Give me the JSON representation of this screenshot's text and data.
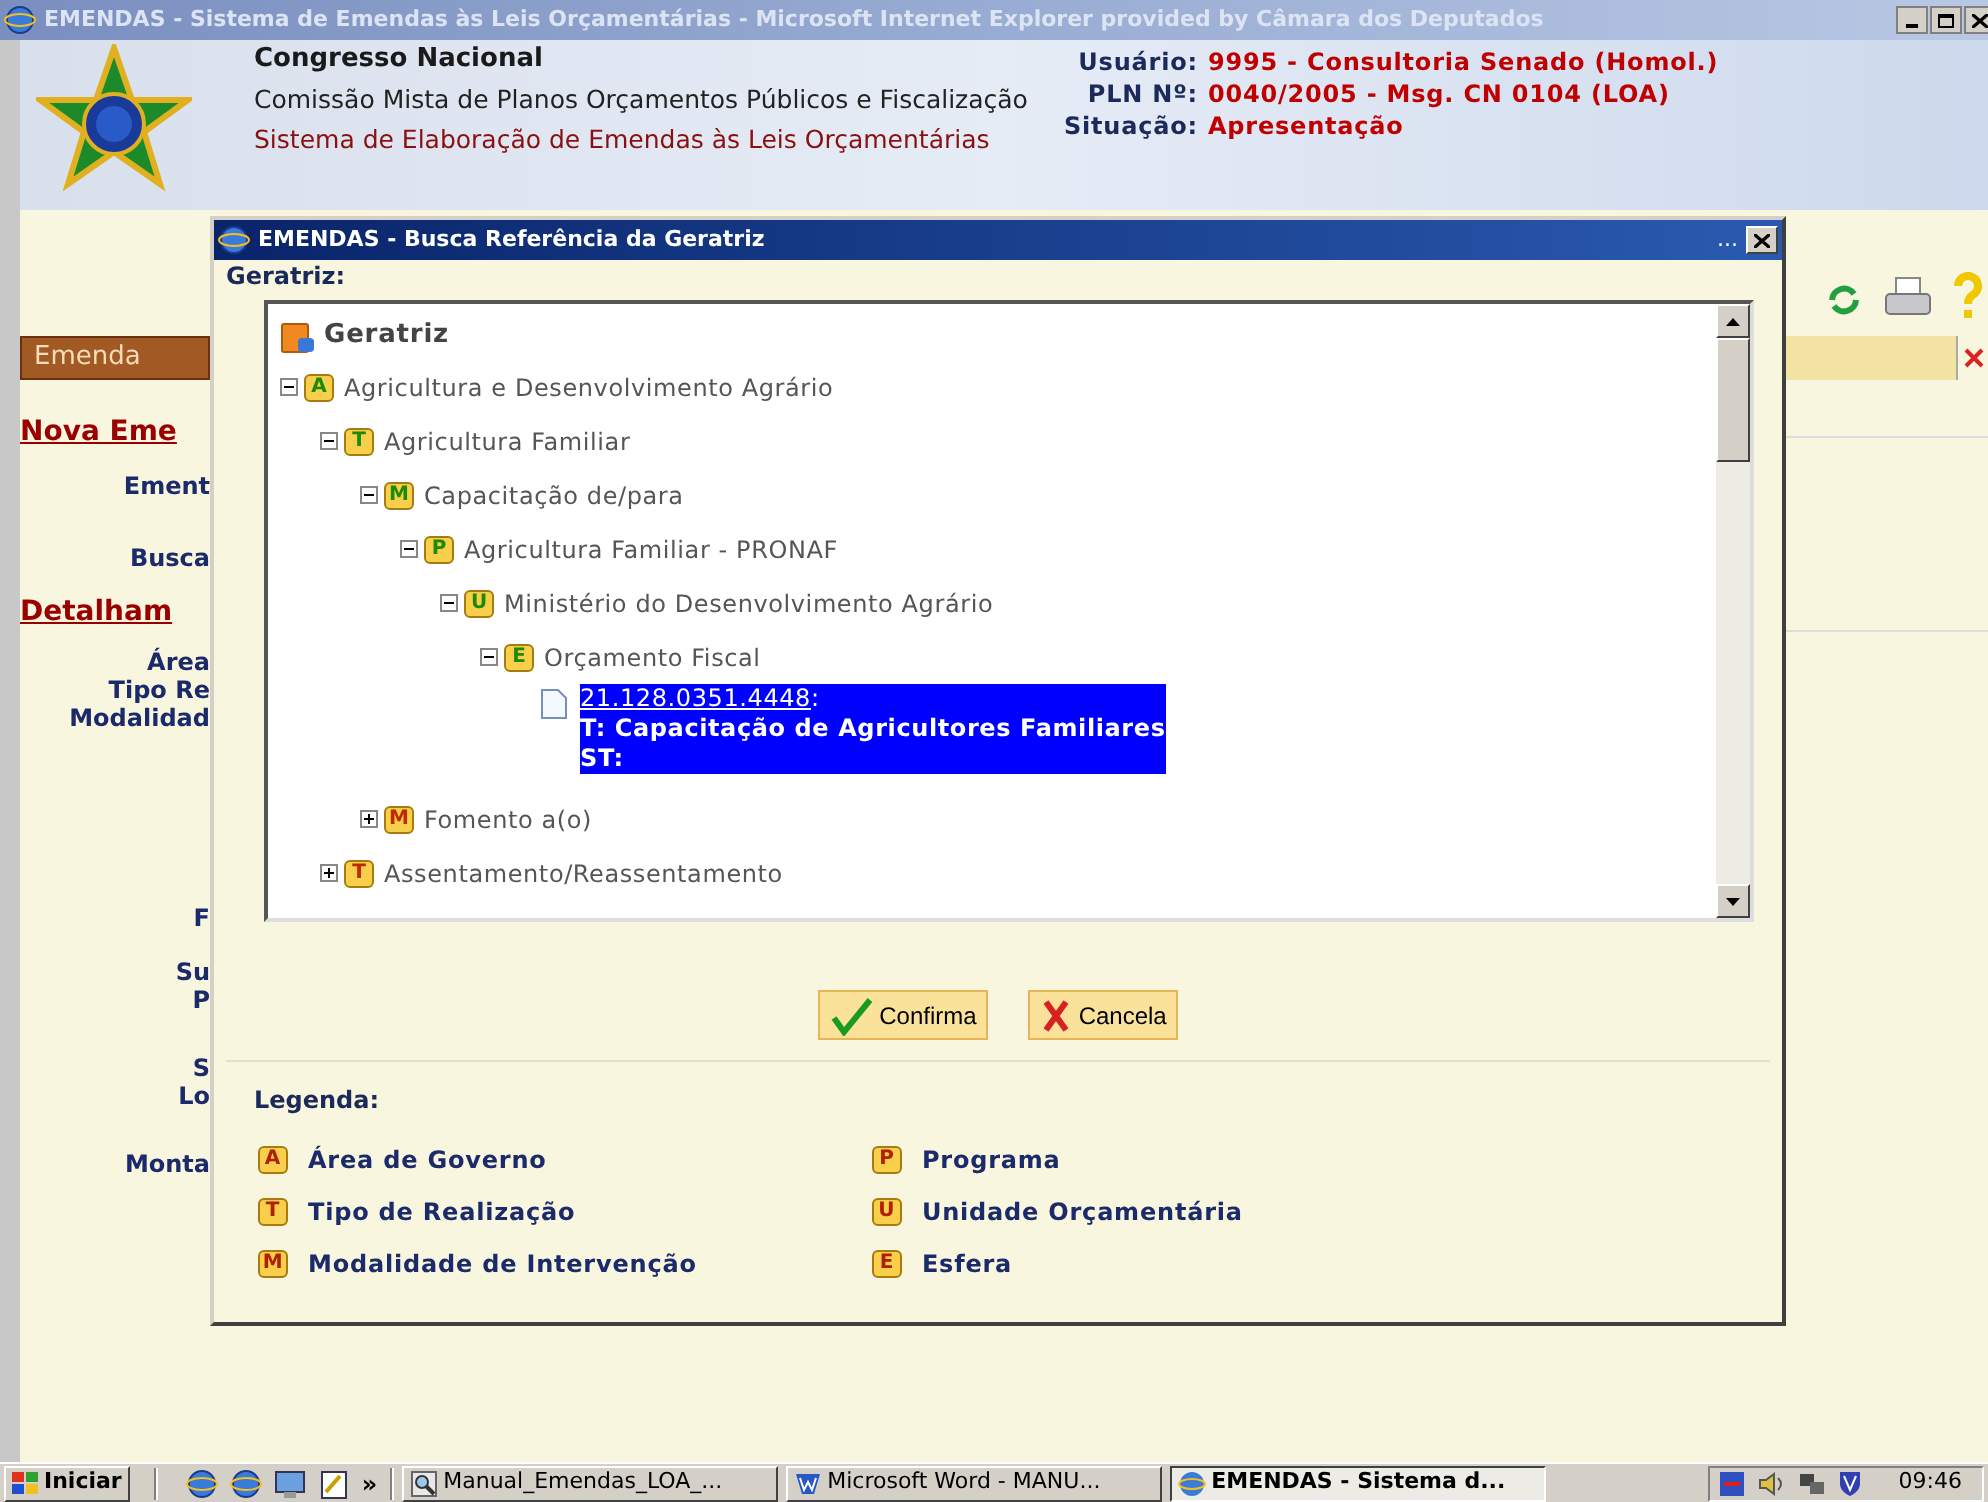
{
  "window": {
    "title": "EMENDAS - Sistema de Emendas às Leis Orçamentárias - Microsoft Internet Explorer provided by Câmara dos Deputados",
    "active": false
  },
  "header": {
    "org": "Congresso Nacional",
    "committee": "Comissão Mista de Planos Orçamentos Públicos e Fiscalização",
    "system": "Sistema de Elaboração de Emendas às Leis Orçamentárias",
    "info": [
      {
        "label": "Usuário:",
        "value": "9995 - Consultoria Senado (Homol.)"
      },
      {
        "label": "PLN Nº:",
        "value": "0040/2005 - Msg. CN 0104 (LOA)"
      },
      {
        "label": "Situação:",
        "value": "Apresentação"
      }
    ]
  },
  "sidebar": {
    "section": "Emenda",
    "items": [
      {
        "kind": "heading",
        "label": "Nova Eme"
      },
      {
        "kind": "field",
        "label": "Ement"
      },
      {
        "kind": "field",
        "label": "Busca"
      },
      {
        "kind": "heading",
        "label": "Detalham"
      },
      {
        "kind": "field",
        "label": "Área"
      },
      {
        "kind": "field",
        "label": "Tipo Re"
      },
      {
        "kind": "field",
        "label": "Modalidad"
      },
      {
        "kind": "field",
        "label": "F"
      },
      {
        "kind": "field",
        "label": "Su"
      },
      {
        "kind": "field",
        "label": "P"
      },
      {
        "kind": "field",
        "label": "S"
      },
      {
        "kind": "field",
        "label": "Lo"
      },
      {
        "kind": "field",
        "label": "Monta"
      }
    ]
  },
  "dialog": {
    "title": "EMENDAS - Busca Referência da Geratriz",
    "title_dots": "...",
    "field_label": "Geratriz:",
    "tree": {
      "label": "Geratriz",
      "children": [
        {
          "kind": "group",
          "badge": "A",
          "label": "Agricultura e Desenvolvimento Agrário",
          "expanded": true,
          "children": [
            {
              "kind": "group",
              "badge": "T",
              "label": "Agricultura Familiar",
              "expanded": true,
              "children": [
                {
                  "kind": "group",
                  "badge": "M",
                  "label": "Capacitação de/para",
                  "expanded": true,
                  "children": [
                    {
                      "kind": "group",
                      "badge": "P",
                      "label": "Agricultura Familiar - PRONAF",
                      "expanded": true,
                      "children": [
                        {
                          "kind": "group",
                          "badge": "U",
                          "label": "Ministério do Desenvolvimento Agrário",
                          "expanded": true,
                          "children": [
                            {
                              "kind": "group",
                              "badge": "E",
                              "label": "Orçamento Fiscal",
                              "expanded": true,
                              "children": [
                                {
                                  "kind": "entry",
                                  "code": "21.128.0351.4448",
                                  "code_suffix": ":",
                                  "title": "T: Capacitação de Agricultores Familiares",
                                  "subtitle": "ST:",
                                  "selected": true
                                }
                              ]
                            }
                          ]
                        }
                      ]
                    }
                  ]
                },
                {
                  "kind": "group",
                  "badge": "M",
                  "label": "Fomento a(o)",
                  "expanded": false
                }
              ]
            },
            {
              "kind": "group",
              "badge": "T",
              "label": "Assentamento/Reassentamento",
              "expanded": false
            }
          ]
        }
      ]
    },
    "buttons": [
      {
        "kind": "confirm",
        "label": "Confirma"
      },
      {
        "kind": "cancel",
        "label": "Cancela"
      }
    ],
    "legend": {
      "title": "Legenda:",
      "items": [
        {
          "badge": "A",
          "label": "Área de Governo"
        },
        {
          "badge": "T",
          "label": "Tipo de Realização"
        },
        {
          "badge": "M",
          "label": "Modalidade de Intervenção"
        },
        {
          "badge": "P",
          "label": "Programa"
        },
        {
          "badge": "U",
          "label": "Unidade Orçamentária"
        },
        {
          "badge": "E",
          "label": "Esfera"
        }
      ]
    }
  },
  "taskbar": {
    "start": "Iniciar",
    "more": "»",
    "tasks": [
      {
        "kind": "viewer",
        "label": "Manual_Emendas_LOA_...",
        "selected": false
      },
      {
        "kind": "word",
        "label": "Microsoft Word - MANU...",
        "selected": false
      },
      {
        "kind": "browser",
        "label": "EMENDAS - Sistema d...",
        "selected": true
      }
    ],
    "clock": "09:46"
  }
}
